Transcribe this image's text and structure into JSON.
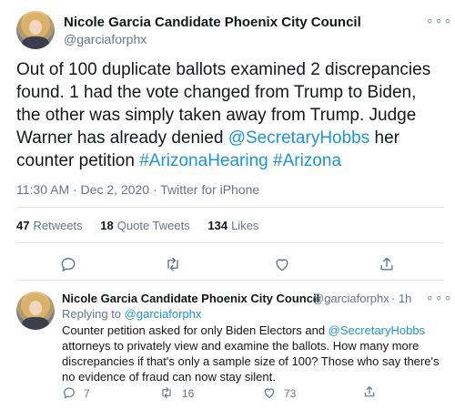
{
  "main_tweet": {
    "author_name": "Nicole Garcia Candidate Phoenix City Council",
    "author_handle": "@garciaforphx",
    "text_1": "Out of 100 duplicate ballots examined 2 discrepancies found. 1 had the vote changed from Trump to Biden, the other was simply taken away from Trump. Judge Warner has already denied ",
    "mention": "@SecretaryHobbs",
    "text_2": " her counter petition ",
    "hashtag_1": "#ArizonaHearing",
    "text_3": " ",
    "hashtag_2": "#Arizona",
    "timestamp": "11:30 AM · Dec 2, 2020 · Twitter for iPhone",
    "retweets_count": "47",
    "retweets_label": "Retweets",
    "quote_count": "18",
    "quote_label": "Quote Tweets",
    "likes_count": "134",
    "likes_label": "Likes",
    "more": "∘∘∘"
  },
  "reply_tweet": {
    "author_name": "Nicole Garcia Candidate Phoenix City Council",
    "author_handle": "@garciaforphx",
    "time": "· 1h",
    "replying_label": "Replying to ",
    "replying_handle": "@garciaforphx",
    "text_1": "Counter petition asked for only Biden Electors and ",
    "mention": "@SecretaryHobbs",
    "text_2": " attorneys to privately view and examine the ballots. How many more discrepancies if that's only a sample size of 100? Those who say there's no evidence of fraud can now stay silent.",
    "reply_count": "7",
    "retweet_count": "16",
    "like_count": "73",
    "more": "∘∘∘"
  },
  "colors": {
    "link": "#1b95e0",
    "muted": "#657786",
    "icon": "#657786",
    "border": "#e1e8ed"
  },
  "icons": [
    "reply-icon",
    "retweet-icon",
    "like-icon",
    "share-icon",
    "more-icon"
  ]
}
